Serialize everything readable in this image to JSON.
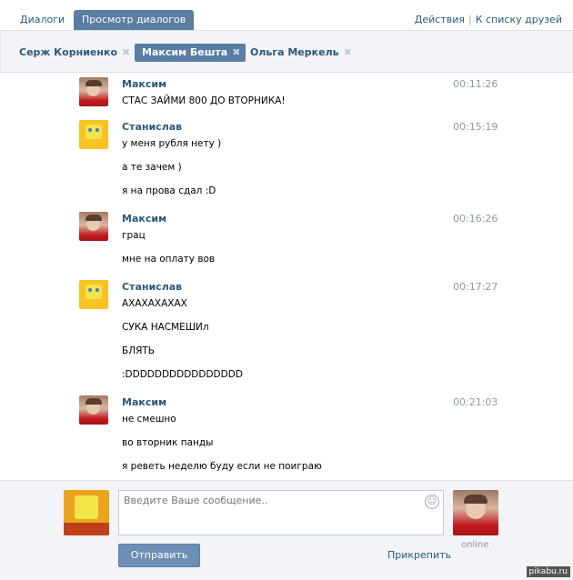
{
  "nav": {
    "tab_dialogs": "Диалоги",
    "tab_view": "Просмотр диалогов",
    "link_actions": "Действия",
    "link_separator": "|",
    "link_friends": "К списку друзей"
  },
  "dialog_tabs": [
    {
      "label": "Серж Корниенко"
    },
    {
      "label": "Максим Бешта"
    },
    {
      "label": "Ольга Меркель"
    }
  ],
  "close_glyph": "✖",
  "messages": [
    {
      "author": "Максим",
      "time": "00:11:26",
      "avatar": "maxim",
      "lines": [
        "СТАС ЗАЙМИ 800 ДО ВТОРНИКА!"
      ]
    },
    {
      "author": "Станислав",
      "time": "00:15:19",
      "avatar": "spongebob",
      "lines": [
        "у меня рубля нету )",
        "а те зачем )",
        "я на прова сдал :D"
      ]
    },
    {
      "author": "Максим",
      "time": "00:16:26",
      "avatar": "maxim",
      "lines": [
        "грац",
        "мне на оплату вов"
      ]
    },
    {
      "author": "Станислав",
      "time": "00:17:27",
      "avatar": "spongebob",
      "lines": [
        "АХАХАХАХАХ",
        "СУКА НАСМЕШИл",
        "БЛЯТЬ",
        ":DDDDDDDDDDDDDDDD"
      ]
    },
    {
      "author": "Максим",
      "time": "00:21:03",
      "avatar": "maxim",
      "lines": [
        "не смешно",
        "во вторник панды",
        "я реветь неделю буду если не поиграю"
      ]
    }
  ],
  "composer": {
    "placeholder": "Введите Ваше сообщение..",
    "smile_glyph": "☺",
    "send_label": "Отправить",
    "attach_label": "Прикрепить",
    "status": "online"
  },
  "watermark": "pikabu.ru"
}
